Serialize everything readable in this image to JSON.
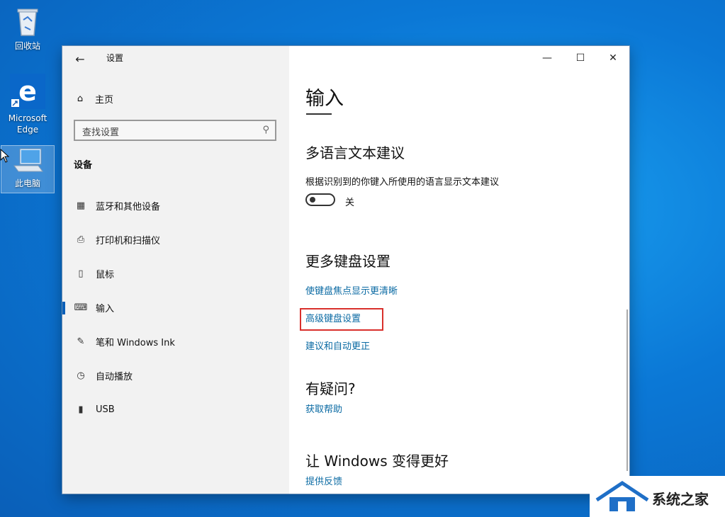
{
  "desktop": {
    "icons": [
      {
        "label": "回收站"
      },
      {
        "label": "Microsoft Edge"
      },
      {
        "label": "此电脑"
      }
    ]
  },
  "window": {
    "title": "设置",
    "controls": {
      "minimize": "—",
      "maximize": "☐",
      "close": "✕"
    }
  },
  "sidebar": {
    "home": "主页",
    "search_placeholder": "查找设置",
    "section": "设备",
    "items": [
      {
        "label": "蓝牙和其他设备",
        "icon": "bluetooth-devices-icon"
      },
      {
        "label": "打印机和扫描仪",
        "icon": "printer-icon"
      },
      {
        "label": "鼠标",
        "icon": "mouse-icon"
      },
      {
        "label": "输入",
        "icon": "keyboard-icon",
        "active": true
      },
      {
        "label": "笔和 Windows Ink",
        "icon": "pen-icon"
      },
      {
        "label": "自动播放",
        "icon": "autoplay-icon"
      },
      {
        "label": "USB",
        "icon": "usb-icon"
      }
    ]
  },
  "main": {
    "title": "输入",
    "multilang_heading": "多语言文本建议",
    "multilang_desc": "根据识别到的你键入所使用的语言显示文本建议",
    "toggle_state": "关",
    "keyboard_heading": "更多键盘设置",
    "links": [
      "使键盘焦点显示更清晰",
      "高级键盘设置",
      "建议和自动更正"
    ],
    "question_heading": "有疑问?",
    "help_link": "获取帮助",
    "improve_heading": "让 Windows 变得更好",
    "feedback_link": "提供反馈"
  },
  "watermark": {
    "text": "系统之家"
  },
  "colors": {
    "accent": "#0a6aa3",
    "highlight": "#d9302c",
    "sidebar_bg": "#f2f2f2"
  }
}
